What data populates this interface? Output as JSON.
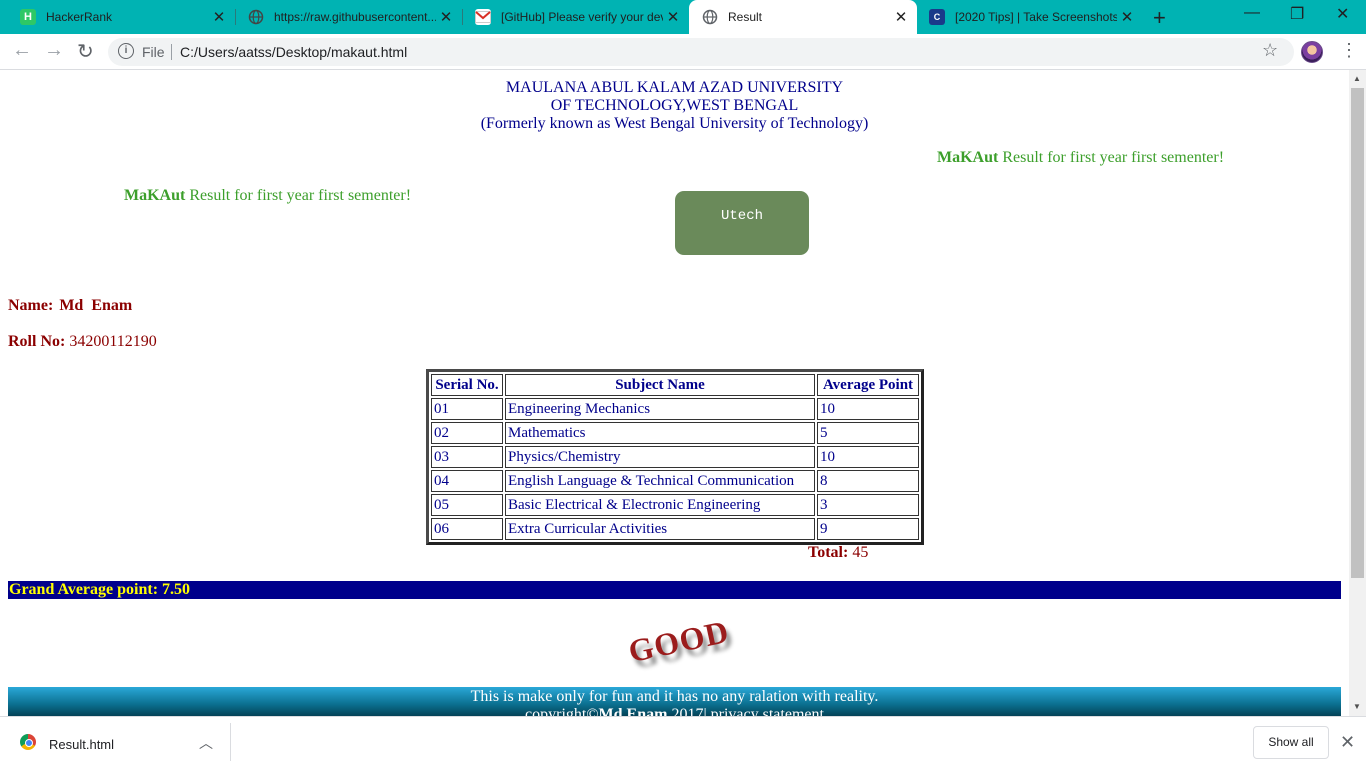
{
  "browser": {
    "tabs": [
      {
        "title": "HackerRank",
        "icon": "hackerrank-icon",
        "active": false
      },
      {
        "title": "https://raw.githubusercontent...",
        "icon": "globe-icon",
        "active": false
      },
      {
        "title": "[GitHub] Please verify your dev...",
        "icon": "gmail-icon",
        "active": false
      },
      {
        "title": "Result",
        "icon": "globe-icon",
        "active": true
      },
      {
        "title": "[2020 Tips] | Take Screenshots",
        "icon": "site-icon",
        "active": false
      }
    ],
    "new_tab": "+",
    "window_controls": {
      "minimize": "—",
      "maximize": "❐",
      "close": "✕"
    },
    "address": {
      "scheme_label": "File",
      "url": "C:/Users/aatss/Desktop/makaut.html"
    }
  },
  "page": {
    "university": {
      "line1": "MAULANA ABUL KALAM AZAD UNIVERSITY",
      "line2": "OF TECHNOLOGY,WEST BENGAL",
      "line3": "(Formerly known as West Bengal University of Technology)"
    },
    "result_banner": {
      "brand": "MaKAut",
      "text": " Result for first year first sementer!"
    },
    "utech_button": "Utech",
    "student": {
      "name_label": "Name:",
      "name": "Md  Enam",
      "roll_label": "Roll No:",
      "roll": " 34200112190"
    },
    "table": {
      "headers": [
        "Serial No.",
        "Subject Name",
        "Average Point"
      ],
      "rows": [
        [
          "01",
          "Engineering Mechanics",
          "10"
        ],
        [
          "02",
          "Mathematics",
          "5"
        ],
        [
          "03",
          "Physics/Chemistry",
          "10"
        ],
        [
          "04",
          "English Language & Technical Communication",
          "8"
        ],
        [
          "05",
          "Basic Electrical & Electronic Engineering",
          "3"
        ],
        [
          "06",
          "Extra Curricular Activities",
          "9"
        ]
      ]
    },
    "total": {
      "label": "Total:",
      "value": " 45"
    },
    "grand_average": "Grand Average point: 7.50",
    "grade_word": "GOOD",
    "footer": {
      "line1": "This is make only for fun and it has no any ralation with reality.",
      "copyright_prefix": "copyright©",
      "author": "Md Enam",
      "copyright_suffix": " 2017| privacy statement"
    }
  },
  "downloads": {
    "file_name": "Result.html",
    "show_all": "Show all"
  },
  "colors": {
    "tabstrip": "#00b3b3",
    "heading_blue": "#00008b",
    "result_green": "#3c9f2b",
    "label_maroon": "#8b0000",
    "grand_bar": "#00008b",
    "grand_text": "#ffff00",
    "utech_bg": "#6a8a5a"
  }
}
